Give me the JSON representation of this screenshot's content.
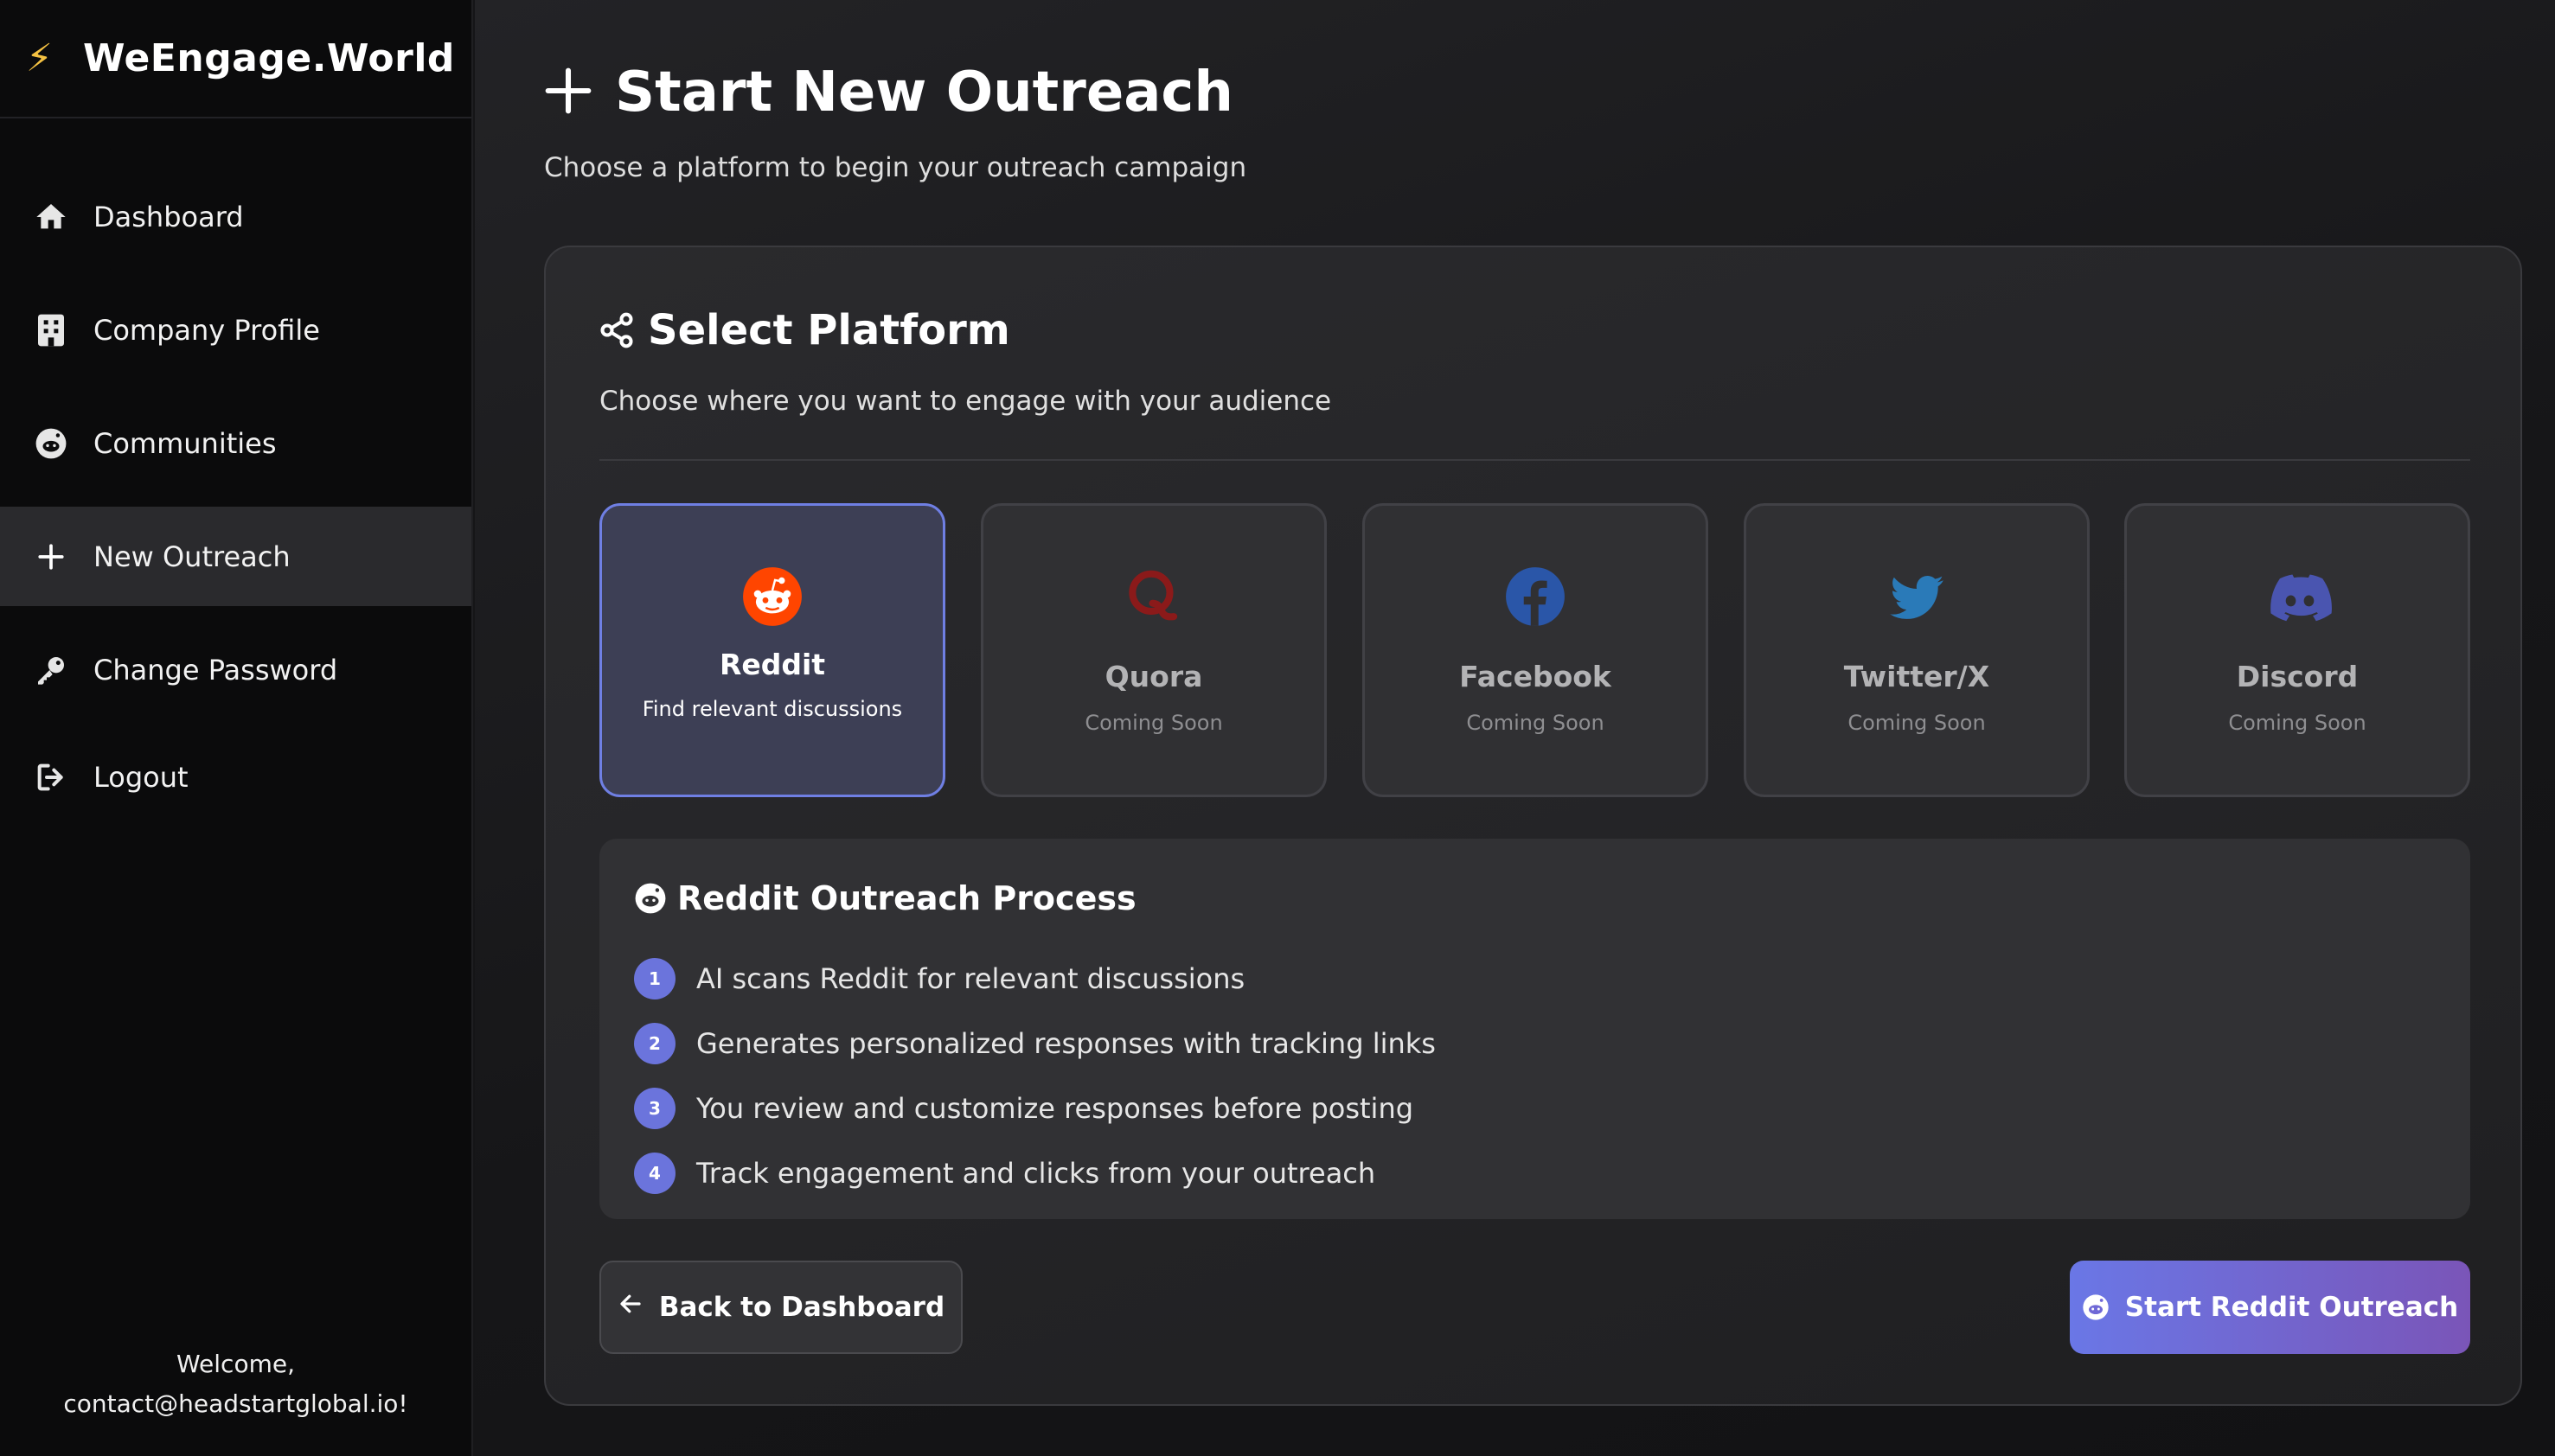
{
  "brand": {
    "icon": "lightning-icon",
    "name": "WeEngage.World",
    "icon_color": "#f5c242"
  },
  "sidebar": {
    "items": [
      {
        "label": "Dashboard",
        "icon": "home-icon"
      },
      {
        "label": "Company Profile",
        "icon": "building-icon"
      },
      {
        "label": "Communities",
        "icon": "reddit-icon"
      },
      {
        "label": "New Outreach",
        "icon": "plus-icon",
        "active": true
      },
      {
        "label": "Change Password",
        "icon": "key-icon"
      },
      {
        "label": "Logout",
        "icon": "logout-icon"
      }
    ],
    "welcome_line1": "Welcome,",
    "welcome_line2": "contact@headstartglobal.io!"
  },
  "page": {
    "title": "Start New Outreach",
    "subtitle": "Choose a platform to begin your outreach campaign"
  },
  "card": {
    "title": "Select Platform",
    "subtitle": "Choose where you want to engage with your audience"
  },
  "platforms": [
    {
      "name": "Reddit",
      "desc": "Find relevant discussions",
      "icon": "reddit-icon",
      "color": "#ff4500",
      "selected": true
    },
    {
      "name": "Quora",
      "desc": "Coming Soon",
      "icon": "quora-icon",
      "color": "#8b1a1a"
    },
    {
      "name": "Facebook",
      "desc": "Coming Soon",
      "icon": "facebook-icon",
      "color": "#2a56a8"
    },
    {
      "name": "Twitter/X",
      "desc": "Coming Soon",
      "icon": "twitter-icon",
      "color": "#2a7ab8"
    },
    {
      "name": "Discord",
      "desc": "Coming Soon",
      "icon": "discord-icon",
      "color": "#4a55b0"
    }
  ],
  "process": {
    "title": "Reddit Outreach Process",
    "steps": [
      {
        "num": "1",
        "text": "AI scans Reddit for relevant discussions"
      },
      {
        "num": "2",
        "text": "Generates personalized responses with tracking links"
      },
      {
        "num": "3",
        "text": "You review and customize responses before posting"
      },
      {
        "num": "4",
        "text": "Track engagement and clicks from your outreach"
      }
    ]
  },
  "buttons": {
    "back": "Back to Dashboard",
    "start": "Start Reddit Outreach"
  },
  "colors": {
    "accent": "#6b74dc",
    "accent_end": "#7a55b8",
    "bg": "#151517"
  }
}
